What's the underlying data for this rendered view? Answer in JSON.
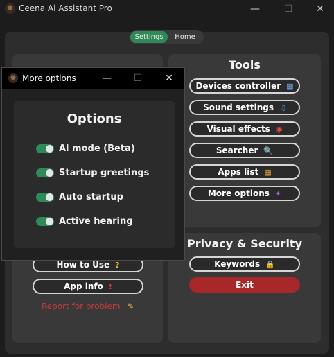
{
  "window": {
    "title": "Ceena Ai Assistant Pro",
    "minimize": "—",
    "maximize": "☐",
    "close": "✕"
  },
  "tabs": {
    "settings": "Settings",
    "home": "Home"
  },
  "tools": {
    "heading": "Tools",
    "buttons": [
      {
        "label": "Devices controller",
        "icon": "devices-icon",
        "glyph": "▦"
      },
      {
        "label": "Sound settings",
        "icon": "sound-icon",
        "glyph": "♫"
      },
      {
        "label": "Visual effects",
        "icon": "chrome-icon",
        "glyph": "◉"
      },
      {
        "label": "Searcher",
        "icon": "magnifier-icon",
        "glyph": "🔍"
      },
      {
        "label": "Apps list",
        "icon": "apps-grid-icon",
        "glyph": "▦"
      },
      {
        "label": "More options",
        "icon": "figma-icon",
        "glyph": "✦"
      }
    ]
  },
  "privacy": {
    "heading": "Privacy & Security",
    "keywords": "Keywords",
    "keywords_glyph": "🔒",
    "exit": "Exit"
  },
  "left": {
    "how_to_use": "How to Use",
    "how_glyph": "?",
    "app_info": "App info",
    "app_info_glyph": "!",
    "report": "Report for problem",
    "report_glyph": "✎"
  },
  "dialog": {
    "title": "More options",
    "minimize": "—",
    "maximize": "☐",
    "close": "✕",
    "heading": "Options",
    "options": [
      {
        "label": "Ai mode (Beta)",
        "on": true
      },
      {
        "label": "Startup greetings",
        "on": true
      },
      {
        "label": "Auto startup",
        "on": true
      },
      {
        "label": "Active hearing",
        "on": true
      }
    ]
  },
  "colors": {
    "accent_green": "#2f8a57",
    "exit_red": "#a8282a",
    "report_red": "#c53a3a"
  }
}
